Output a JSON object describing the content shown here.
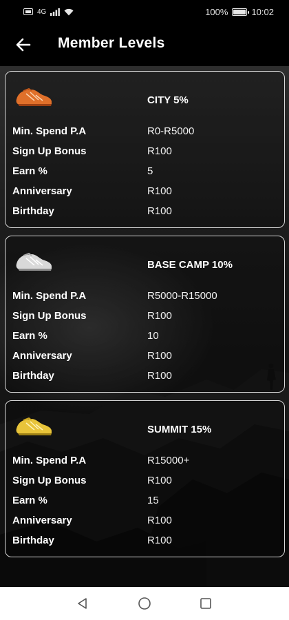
{
  "status_bar": {
    "network": "4G",
    "battery": "100%",
    "time": "10:02"
  },
  "header": {
    "title": "Member Levels",
    "back_icon": "arrow-left-icon"
  },
  "tiers": [
    {
      "title": "CITY 5%",
      "shoe_color": "#e0702a",
      "rows": [
        {
          "label": "Min. Spend P.A",
          "value": "R0-R5000"
        },
        {
          "label": "Sign Up Bonus",
          "value": "R100"
        },
        {
          "label": "Earn %",
          "value": "5"
        },
        {
          "label": "Anniversary",
          "value": "R100"
        },
        {
          "label": "Birthday",
          "value": "R100"
        }
      ]
    },
    {
      "title": "BASE CAMP 10%",
      "shoe_color": "#d9d9d9",
      "rows": [
        {
          "label": "Min. Spend P.A",
          "value": "R5000-R15000"
        },
        {
          "label": "Sign Up Bonus",
          "value": "R100"
        },
        {
          "label": "Earn %",
          "value": "10"
        },
        {
          "label": "Anniversary",
          "value": "R100"
        },
        {
          "label": "Birthday",
          "value": "R100"
        }
      ]
    },
    {
      "title": "SUMMIT 15%",
      "shoe_color": "#e8c43a",
      "rows": [
        {
          "label": "Min. Spend P.A",
          "value": "R15000+"
        },
        {
          "label": "Sign Up Bonus",
          "value": "R100"
        },
        {
          "label": "Earn %",
          "value": "15"
        },
        {
          "label": "Anniversary",
          "value": "R100"
        },
        {
          "label": "Birthday",
          "value": "R100"
        }
      ]
    }
  ],
  "nav_bar": {
    "back_icon": "triangle-back-icon",
    "home_icon": "circle-home-icon",
    "recent_icon": "square-recents-icon"
  }
}
